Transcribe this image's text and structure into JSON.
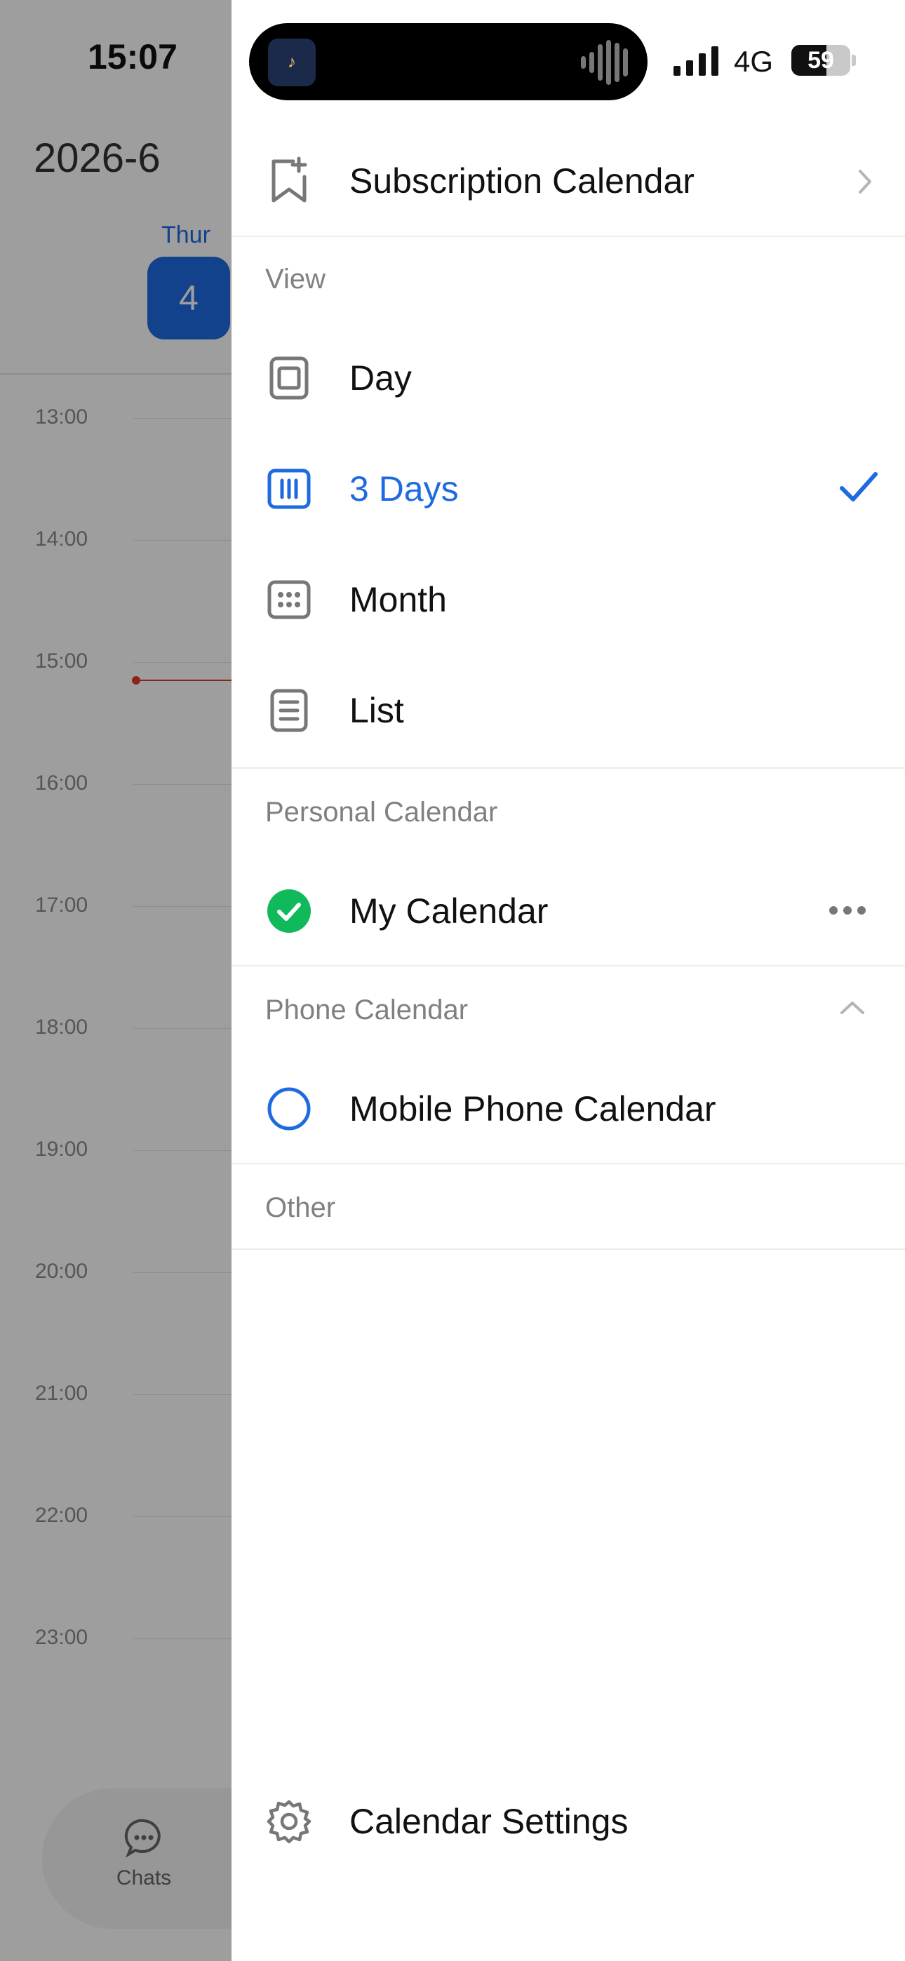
{
  "status_bar": {
    "time": "15:07",
    "network": "4G",
    "battery": "59",
    "battery_level": 0.59
  },
  "background": {
    "month_title": "2026-6",
    "weekday": "Thur",
    "date": "4",
    "hours": [
      "13:00",
      "14:00",
      "15:00",
      "16:00",
      "17:00",
      "18:00",
      "19:00",
      "20:00",
      "21:00",
      "22:00",
      "23:00"
    ],
    "tab_chats": "Chats"
  },
  "drawer": {
    "subscription": {
      "label": "Subscription Calendar",
      "icon": "bookmark-plus-icon"
    },
    "view": {
      "section_label": "View",
      "items": [
        {
          "label": "Day",
          "icon": "day-view-icon",
          "selected": false
        },
        {
          "label": "3 Days",
          "icon": "three-days-view-icon",
          "selected": true
        },
        {
          "label": "Month",
          "icon": "month-view-icon",
          "selected": false
        },
        {
          "label": "List",
          "icon": "list-view-icon",
          "selected": false
        }
      ]
    },
    "personal": {
      "section_label": "Personal Calendar",
      "calendar_label": "My Calendar",
      "checked": true
    },
    "phone": {
      "section_label": "Phone Calendar",
      "calendar_label": "Mobile Phone Calendar",
      "checked": false
    },
    "other": {
      "section_label": "Other"
    },
    "settings": {
      "label": "Calendar Settings",
      "icon": "gear-icon"
    }
  },
  "colors": {
    "accent": "#1e6be0",
    "check_green": "#10b95a",
    "now_line": "#e23a2a"
  }
}
